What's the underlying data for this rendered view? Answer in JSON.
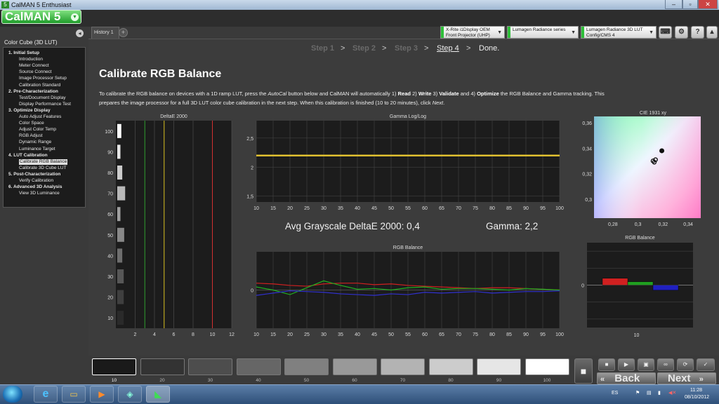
{
  "window": {
    "title": "CalMAN 5 Enthusiast",
    "app_icon": "5"
  },
  "window_controls": {
    "minimize": "–",
    "restore": "▫",
    "close": "✕"
  },
  "logo": {
    "text": "CalMAN 5"
  },
  "devices": [
    {
      "line1": "X-Rite i1Display OEM",
      "line2": "Front Projector (UHP)"
    },
    {
      "line1": "Lumagen Radiance series",
      "line2": ""
    },
    {
      "line1": "Lumagen Radiance 3D LUT",
      "line2": "Config/CMS 4"
    }
  ],
  "tab": {
    "label": "History 1",
    "add": "+"
  },
  "left_panel": {
    "title": "Color Cube (3D LUT)",
    "sections": [
      {
        "label": "1. Initial Setup",
        "items": [
          "Introduction",
          "Meter Connect",
          "Source Connect",
          "Image Processor Setup",
          "Calibration Standard"
        ]
      },
      {
        "label": "2. Pre-Characterization",
        "items": [
          "Test/Document Display",
          "Display Performance Test"
        ]
      },
      {
        "label": "3. Optimize Display",
        "items": [
          "Auto Adjust Features",
          "Color Space",
          "Adjust Color Temp",
          "RGB Adjust",
          "Dynamic Range",
          "Luminance Target"
        ]
      },
      {
        "label": "4. LUT Calibration",
        "items": [
          "Calibrate RGB Balance",
          "Calibrate 3D Cube LUT"
        ]
      },
      {
        "label": "5. Post-Characterization",
        "items": [
          "Verify Calibration"
        ]
      },
      {
        "label": "6. Advanced 3D Analysis",
        "items": [
          "View 3D Luminance"
        ]
      }
    ],
    "selected": "Calibrate RGB Balance"
  },
  "steps": {
    "s1": "Step 1",
    "s2": "Step 2",
    "s3": "Step 3",
    "s4": "Step 4",
    "done": "Done.",
    "sep": ">"
  },
  "page": {
    "title": "Calibrate RGB Balance",
    "desc_1": "To calibrate the RGB balance on devices with a 1D ramp LUT, press the ",
    "desc_autocal": "AutoCal",
    "desc_2": " button below and CalMAN will automatically  1) ",
    "desc_read": "Read",
    "desc_3": "  2) ",
    "desc_write": "Write",
    "desc_4": "  3) ",
    "desc_validate": "Validate",
    "desc_5": "  and 4) ",
    "desc_optimize": "Optimize",
    "desc_6": " the RGB Balance and Gamma tracking. This prepares the image processor for a full 3D LUT color cube calibration in the next step. When this calibration is finished (10 to 20 minutes), click ",
    "desc_next": "Next",
    "desc_7": "."
  },
  "stats": {
    "avg_de": "Avg Grayscale DeltaE 2000: 0,4",
    "gamma": "Gamma: 2,2"
  },
  "chart_data": [
    {
      "type": "bar",
      "title": "DeltaE 2000",
      "orientation": "horizontal",
      "categories": [
        "100",
        "90",
        "80",
        "70",
        "60",
        "50",
        "40",
        "30",
        "20",
        "10"
      ],
      "values": [
        0.2,
        0.05,
        0.3,
        0.6,
        0.05,
        0.5,
        0.3,
        0.45,
        0.45,
        0.45
      ],
      "bar_colors": [
        "#ffffff",
        "#e6e6e6",
        "#cccccc",
        "#b8b8b8",
        "#a0a0a0",
        "#888888",
        "#6e6e6e",
        "#575757",
        "#3f3f3f",
        "#2a2a2a"
      ],
      "xticks": [
        "2",
        "4",
        "6",
        "8",
        "10",
        "12"
      ],
      "xlim": [
        0,
        12
      ],
      "threshold_lines": [
        {
          "x": 3,
          "color": "#2e9e2e"
        },
        {
          "x": 5,
          "color": "#d8c020"
        },
        {
          "x": 10,
          "color": "#d23030"
        }
      ],
      "grid": true
    },
    {
      "type": "line",
      "title": "Gamma Log/Log",
      "x": [
        10,
        15,
        20,
        25,
        30,
        35,
        40,
        45,
        50,
        55,
        60,
        65,
        70,
        75,
        80,
        85,
        90,
        95,
        100
      ],
      "series": [
        {
          "values": [
            2.2,
            2.2,
            2.2,
            2.2,
            2.2,
            2.2,
            2.2,
            2.2,
            2.2,
            2.2,
            2.2,
            2.2,
            2.2,
            2.2,
            2.2,
            2.2,
            2.2,
            2.2,
            2.2
          ],
          "color": "#e0c030"
        }
      ],
      "yticks": [
        "1,5",
        "2",
        "2,5"
      ],
      "ylim": [
        1.4,
        2.8
      ],
      "xlim": [
        10,
        100
      ],
      "grid": true
    },
    {
      "type": "line",
      "title": "RGB Balance",
      "x": [
        10,
        15,
        20,
        25,
        30,
        35,
        40,
        45,
        50,
        55,
        60,
        65,
        70,
        75,
        80,
        85,
        90,
        95,
        100
      ],
      "series": [
        {
          "color": "#d02020",
          "values": [
            0.9,
            0.8,
            0.6,
            0.5,
            0.8,
            0.9,
            0.9,
            0.7,
            0.8,
            0.6,
            0.5,
            0.4,
            0.3,
            0.2,
            0.3,
            0.3,
            0.2,
            0.1,
            0.0
          ]
        },
        {
          "color": "#20b020",
          "values": [
            0.4,
            0.0,
            -0.6,
            0.3,
            1.2,
            0.6,
            0.1,
            0.2,
            0.0,
            0.3,
            0.4,
            0.1,
            0.2,
            0.2,
            0.1,
            0.0,
            0.2,
            0.1,
            0.0
          ]
        },
        {
          "color": "#3030d0",
          "values": [
            -0.7,
            -0.4,
            -0.1,
            -0.2,
            -0.3,
            -0.5,
            -0.6,
            -0.7,
            -0.5,
            -0.6,
            -0.3,
            -0.4,
            -0.3,
            -0.2,
            -0.4,
            -0.3,
            -0.2,
            -0.2,
            -0.1
          ]
        }
      ],
      "ylim": [
        -5,
        5
      ],
      "xlim": [
        10,
        100
      ],
      "grid": true
    },
    {
      "type": "scatter",
      "title": "CIE 1931 xy",
      "points": [
        {
          "x": 0.313,
          "y": 0.329
        },
        {
          "x": 0.312,
          "y": 0.33
        },
        {
          "x": 0.314,
          "y": 0.331
        },
        {
          "x": 0.319,
          "y": 0.338
        }
      ],
      "xticks": [
        "0,28",
        "0,3",
        "0,32",
        "0,34"
      ],
      "yticks": [
        "0,36",
        "0,34",
        "0,32",
        "0,3"
      ],
      "xlim": [
        0.265,
        0.35
      ],
      "ylim": [
        0.285,
        0.365
      ]
    },
    {
      "type": "bar",
      "title": "RGB Balance",
      "categories": [
        "10"
      ],
      "series": [
        {
          "values": [
            0.8
          ],
          "color": "#d02020"
        },
        {
          "values": [
            0.4
          ],
          "color": "#20a020"
        },
        {
          "values": [
            -0.6
          ],
          "color": "#2020c0"
        }
      ],
      "ylim": [
        -5,
        5
      ],
      "grid": true
    }
  ],
  "swatches": {
    "labels": [
      "10",
      "20",
      "30",
      "40",
      "50",
      "60",
      "70",
      "80",
      "90",
      "100"
    ],
    "colors": [
      "#1a1a1a",
      "#333333",
      "#4d4d4d",
      "#666666",
      "#808080",
      "#999999",
      "#b3b3b3",
      "#cccccc",
      "#e6e6e6",
      "#ffffff"
    ],
    "selected": "10"
  },
  "controls": {
    "back": "Back",
    "next": "Next"
  },
  "tray": {
    "lang": "ES",
    "time": "11:28",
    "date": "08/10/2012"
  }
}
